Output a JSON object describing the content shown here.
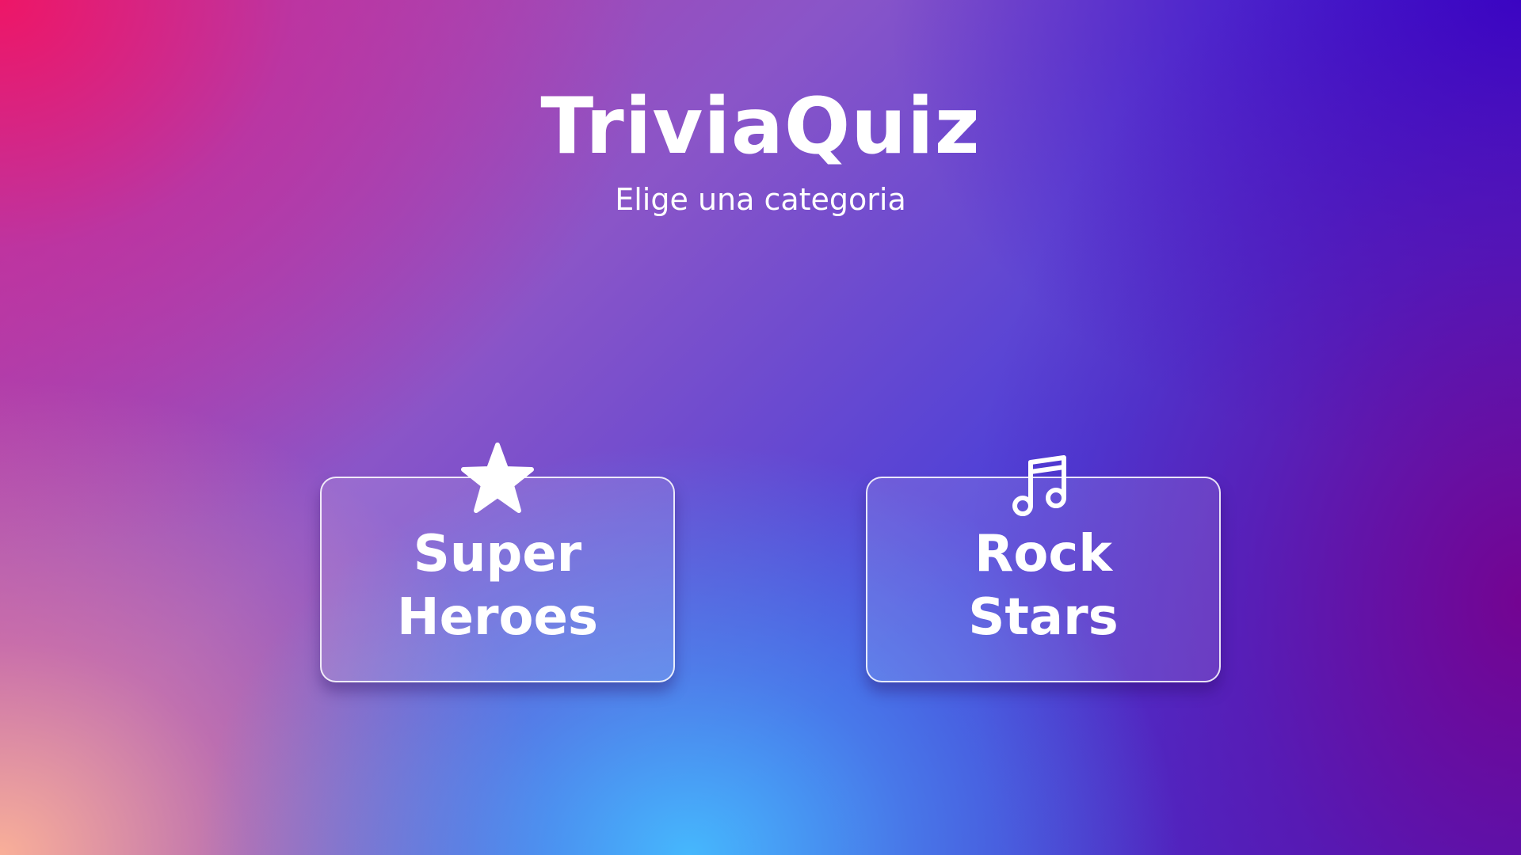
{
  "header": {
    "title": "TriviaQuiz",
    "subtitle": "Elige una categoria"
  },
  "categories": [
    {
      "icon": "star-icon",
      "label_line1": "Super",
      "label_line2": "Heroes"
    },
    {
      "icon": "music-note-icon",
      "label_line1": "Rock",
      "label_line2": "Stars"
    }
  ],
  "colors": {
    "text": "#ffffff",
    "gradient_pink": "#f0146a",
    "gradient_peach": "#ffb49a",
    "gradient_sky": "#46beff",
    "gradient_indigo": "#3a00c8",
    "gradient_purple": "#78008c"
  }
}
